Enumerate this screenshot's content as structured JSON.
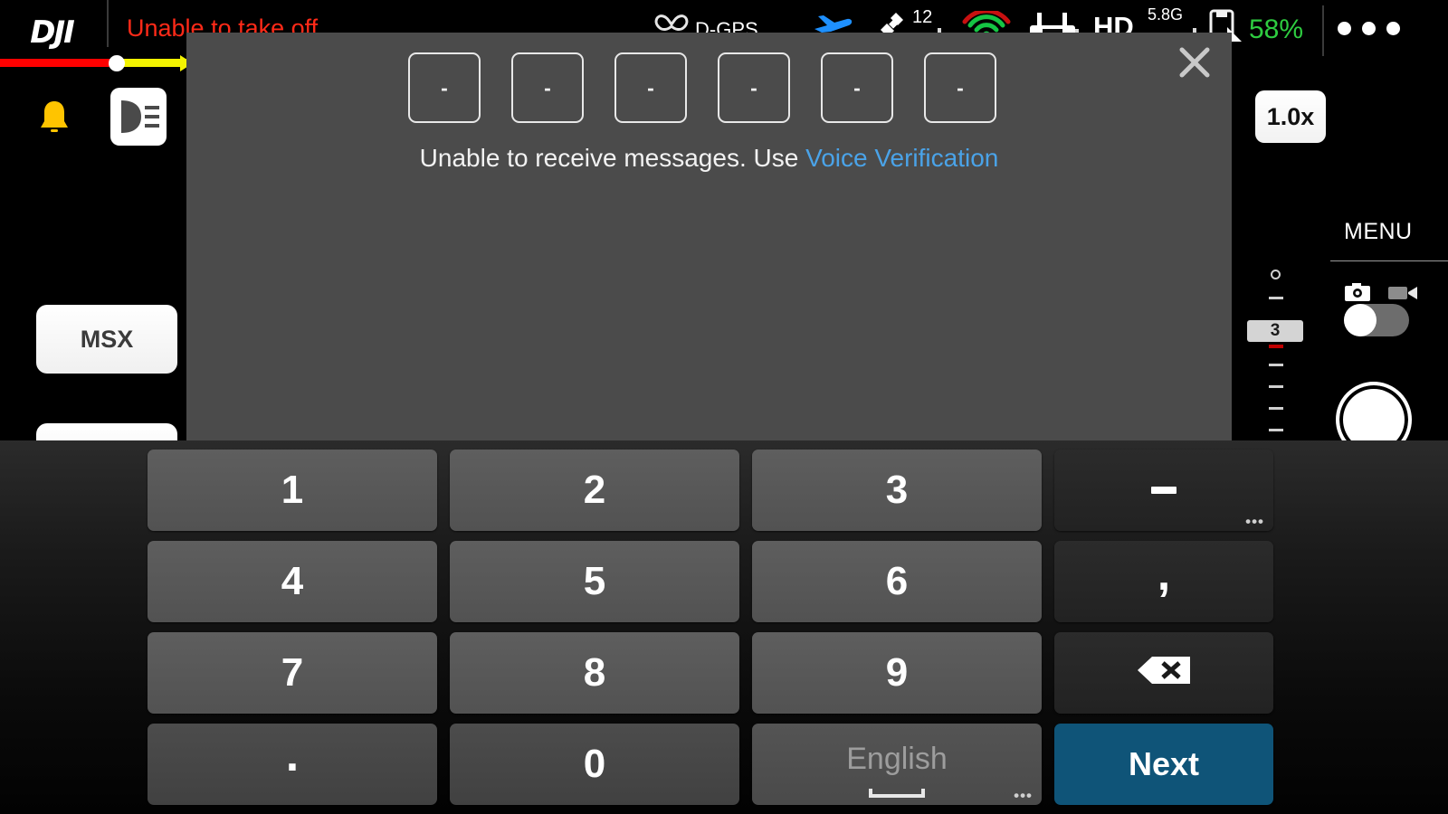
{
  "app": {
    "brand": "DJI",
    "warning": "Unable to take off",
    "battery": "58%"
  },
  "status_bar": {
    "gps_label": "D-GPS",
    "satellites": "12",
    "video_quality": "HD",
    "frequency": "5.8G",
    "icons": {
      "gps": "gps-icon",
      "aircraft": "aircraft-icon",
      "satellite": "satellite-icon",
      "wifi": "wifi-icon",
      "controller": "remote-controller-icon",
      "sdcard": "sdcard-icon",
      "more": "more-dots-icon"
    }
  },
  "left_rail": {
    "bell": "notification-bell-icon",
    "light": "headlight-icon",
    "msx_label": "MSX"
  },
  "right_rail": {
    "zoom_label": "1.0x",
    "menu_label": "MENU",
    "camera_icon": "camera-icon",
    "video_icon": "video-camera-icon",
    "exposure_value": "3"
  },
  "dialog": {
    "close_icon": "close-icon",
    "otp_digits": [
      "-",
      "-",
      "-",
      "-",
      "-",
      "-"
    ],
    "message_prefix": "Unable to receive messages. Use ",
    "message_link": "Voice Verification"
  },
  "keyboard": {
    "rows": [
      [
        {
          "label": "1",
          "type": "num"
        },
        {
          "label": "2",
          "type": "num"
        },
        {
          "label": "3",
          "type": "num"
        },
        {
          "label": "-",
          "type": "side",
          "name": "key-hyphen",
          "ellipsis": "•••"
        }
      ],
      [
        {
          "label": "4",
          "type": "num"
        },
        {
          "label": "5",
          "type": "num"
        },
        {
          "label": "6",
          "type": "num"
        },
        {
          "label": ",",
          "type": "side",
          "name": "key-comma"
        }
      ],
      [
        {
          "label": "7",
          "type": "num"
        },
        {
          "label": "8",
          "type": "num"
        },
        {
          "label": "9",
          "type": "num"
        },
        {
          "label": "⌫",
          "type": "side",
          "name": "key-backspace"
        }
      ],
      [
        {
          "label": ".",
          "type": "num-dark",
          "name": "key-period"
        },
        {
          "label": "0",
          "type": "num-dark"
        },
        {
          "label": "English",
          "type": "space",
          "name": "key-space",
          "ellipsis": "•••"
        },
        {
          "label": "Next",
          "type": "next",
          "name": "key-next"
        }
      ]
    ]
  },
  "colors": {
    "accent_blue": "#0f5478",
    "link_blue": "#4aa3e8",
    "warning_red": "#ff2a18",
    "battery_green": "#2ecc40",
    "dialog_bg": "#4b4b4b"
  }
}
